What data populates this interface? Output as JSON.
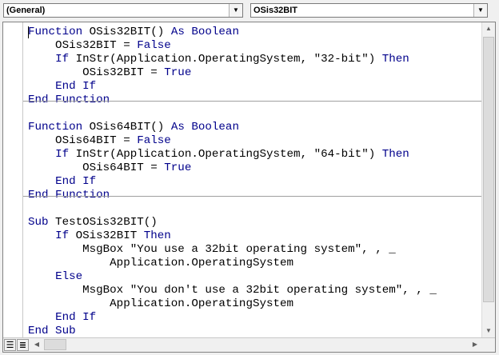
{
  "toolbar": {
    "object_combo": {
      "value": "(General)",
      "arrow": "▼"
    },
    "procedure_combo": {
      "value": "OSis32BIT",
      "arrow": "▼"
    }
  },
  "code_lines": [
    [
      {
        "t": "Function",
        "k": true
      },
      {
        "t": " OSis32BIT() "
      },
      {
        "t": "As",
        "k": true
      },
      {
        "t": " "
      },
      {
        "t": "Boolean",
        "k": true
      }
    ],
    [
      {
        "t": "    OSis32BIT = "
      },
      {
        "t": "False",
        "k": true
      }
    ],
    [
      {
        "t": "    "
      },
      {
        "t": "If",
        "k": true
      },
      {
        "t": " InStr(Application.OperatingSystem, \"32-bit\") "
      },
      {
        "t": "Then",
        "k": true
      }
    ],
    [
      {
        "t": "        OSis32BIT = "
      },
      {
        "t": "True",
        "k": true
      }
    ],
    [
      {
        "t": "    "
      },
      {
        "t": "End If",
        "k": true
      }
    ],
    [
      {
        "t": "End Function",
        "k": true
      }
    ],
    [],
    [
      {
        "t": "Function",
        "k": true
      },
      {
        "t": " OSis64BIT() "
      },
      {
        "t": "As",
        "k": true
      },
      {
        "t": " "
      },
      {
        "t": "Boolean",
        "k": true
      }
    ],
    [
      {
        "t": "    OSis64BIT = "
      },
      {
        "t": "False",
        "k": true
      }
    ],
    [
      {
        "t": "    "
      },
      {
        "t": "If",
        "k": true
      },
      {
        "t": " InStr(Application.OperatingSystem, \"64-bit\") "
      },
      {
        "t": "Then",
        "k": true
      }
    ],
    [
      {
        "t": "        OSis64BIT = "
      },
      {
        "t": "True",
        "k": true
      }
    ],
    [
      {
        "t": "    "
      },
      {
        "t": "End If",
        "k": true
      }
    ],
    [
      {
        "t": "End Function",
        "k": true
      }
    ],
    [],
    [
      {
        "t": "Sub",
        "k": true
      },
      {
        "t": " TestOSis32BIT()"
      }
    ],
    [
      {
        "t": "    "
      },
      {
        "t": "If",
        "k": true
      },
      {
        "t": " OSis32BIT "
      },
      {
        "t": "Then",
        "k": true
      }
    ],
    [
      {
        "t": "        MsgBox \"You use a 32bit operating system\", , _"
      }
    ],
    [
      {
        "t": "            Application.OperatingSystem"
      }
    ],
    [
      {
        "t": "    "
      },
      {
        "t": "Else",
        "k": true
      }
    ],
    [
      {
        "t": "        MsgBox \"You don't use a 32bit operating system\", , _"
      }
    ],
    [
      {
        "t": "            Application.OperatingSystem"
      }
    ],
    [
      {
        "t": "    "
      },
      {
        "t": "End If",
        "k": true
      }
    ],
    [
      {
        "t": "End Sub",
        "k": true
      }
    ]
  ],
  "procedure_separators_after_lines": [
    6,
    13
  ],
  "colors": {
    "keyword": "#00008b",
    "text": "#000000",
    "separator": "#a0a0a0"
  },
  "scrollbars": {
    "up_arrow": "▲",
    "down_arrow": "▼",
    "left_arrow": "◀",
    "right_arrow": "▶"
  },
  "view_buttons": {
    "procedure_view_icon": "☰",
    "full_module_view_icon": "≣"
  }
}
